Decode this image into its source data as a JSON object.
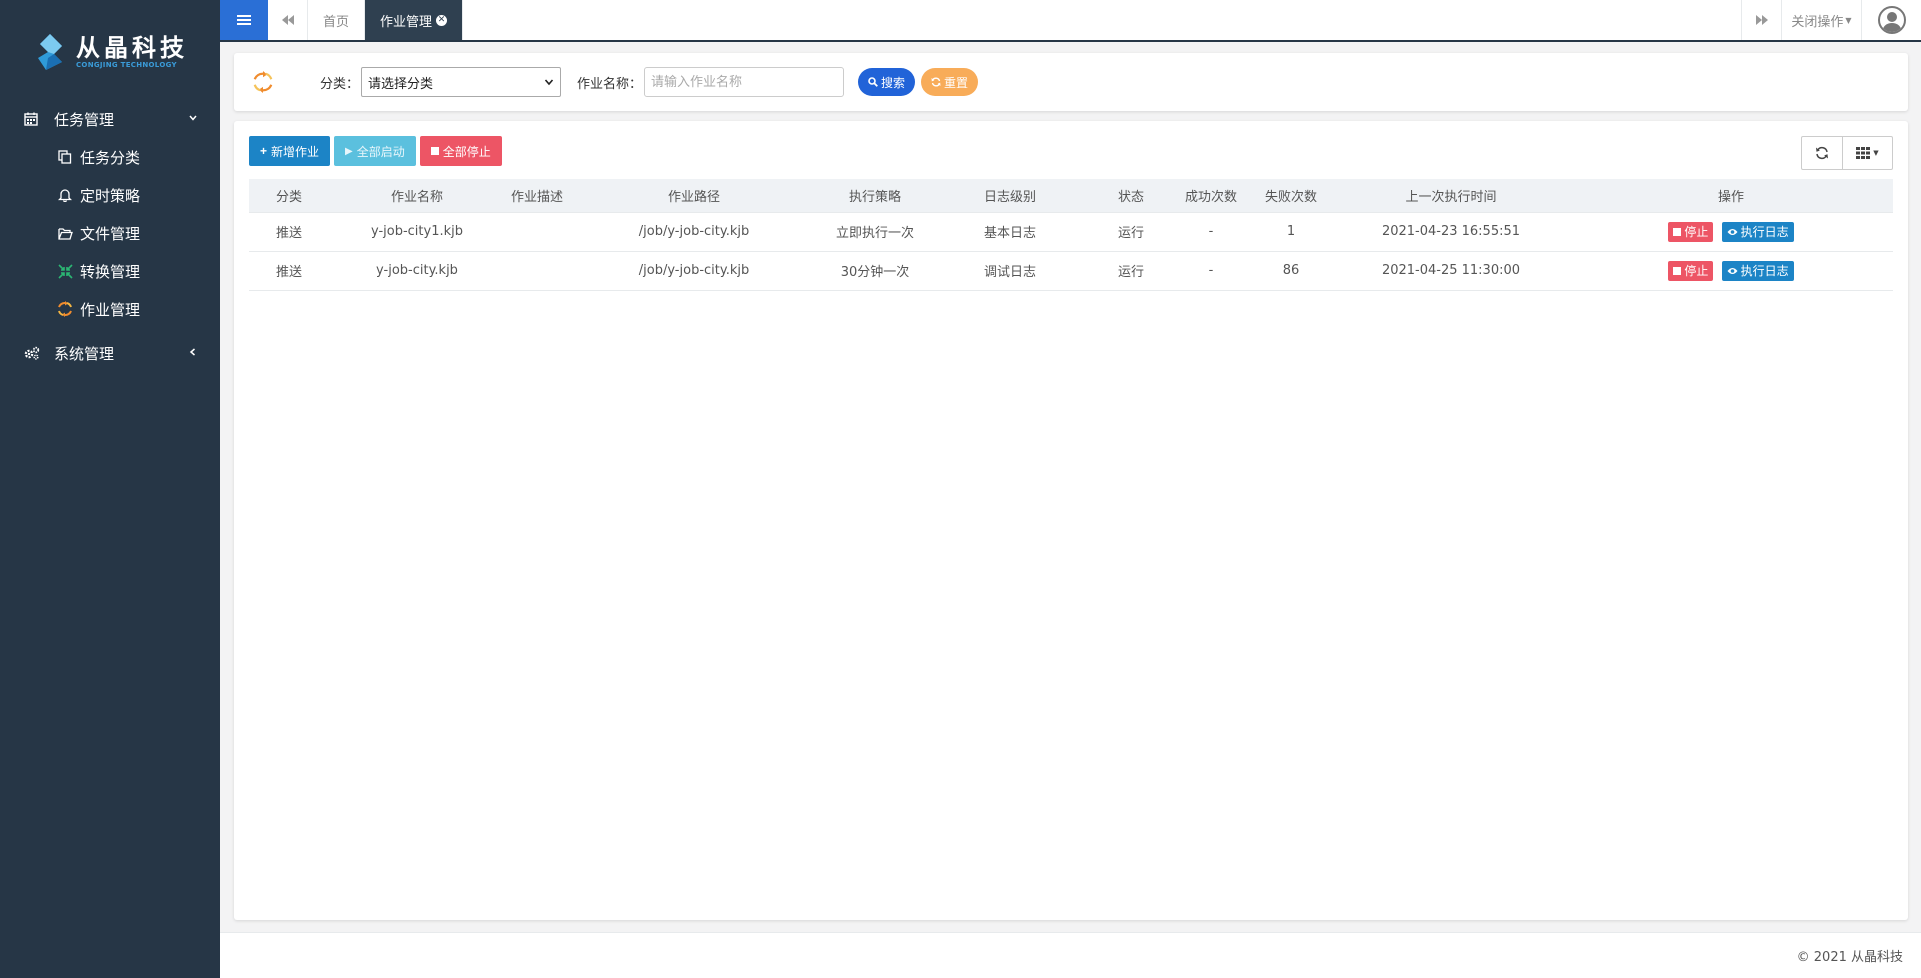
{
  "brand": {
    "name": "从晶科技",
    "subtitle": "CONGJING TECHNOLOGY"
  },
  "sidebar": {
    "groups": [
      {
        "label": "任务管理",
        "icon": "calendar-icon",
        "expanded": true,
        "items": [
          {
            "label": "任务分类",
            "icon": "copy-icon"
          },
          {
            "label": "定时策略",
            "icon": "bell-icon"
          },
          {
            "label": "文件管理",
            "icon": "folder-open-icon"
          },
          {
            "label": "转换管理",
            "icon": "transform-icon"
          },
          {
            "label": "作业管理",
            "icon": "job-icon"
          }
        ]
      },
      {
        "label": "系统管理",
        "icon": "gears-icon",
        "expanded": false,
        "items": []
      }
    ]
  },
  "topbar": {
    "tabs": [
      {
        "label": "首页",
        "active": false
      },
      {
        "label": "作业管理",
        "active": true
      }
    ],
    "close_ops_label": "关闭操作"
  },
  "search": {
    "category_label": "分类：",
    "category_value": "请选择分类",
    "name_label": "作业名称：",
    "name_placeholder": "请输入作业名称",
    "search_button": "搜索",
    "reset_button": "重置"
  },
  "toolbar": {
    "add_label": "新增作业",
    "start_all_label": "全部启动",
    "stop_all_label": "全部停止"
  },
  "table": {
    "columns": [
      "分类",
      "作业名称",
      "作业描述",
      "作业路径",
      "执行策略",
      "日志级别",
      "状态",
      "成功次数",
      "失败次数",
      "上一次执行时间",
      "操作"
    ],
    "rows": [
      {
        "category": "推送",
        "name": "y-job-city1.kjb",
        "description": "",
        "path": "/job/y-job-city.kjb",
        "strategy": "立即执行一次",
        "log_level": "基本日志",
        "status": "运行",
        "success": "-",
        "fail": "1",
        "last_time": "2021-04-23 16:55:51",
        "stop_label": "停止",
        "log_label": "执行日志"
      },
      {
        "category": "推送",
        "name": "y-job-city.kjb",
        "description": "",
        "path": "/job/y-job-city.kjb",
        "strategy": "30分钟一次",
        "log_level": "调试日志",
        "status": "运行",
        "success": "-",
        "fail": "86",
        "last_time": "2021-04-25 11:30:00",
        "stop_label": "停止",
        "log_label": "执行日志"
      }
    ]
  },
  "footer": {
    "text": "© 2021 从晶科技"
  },
  "colors": {
    "sidebar_bg": "#263646",
    "menu_btn": "#2a6fd6",
    "primary": "#1c84c6",
    "danger": "#ed5565",
    "warning": "#f8ac59",
    "info": "#5bc0de"
  }
}
